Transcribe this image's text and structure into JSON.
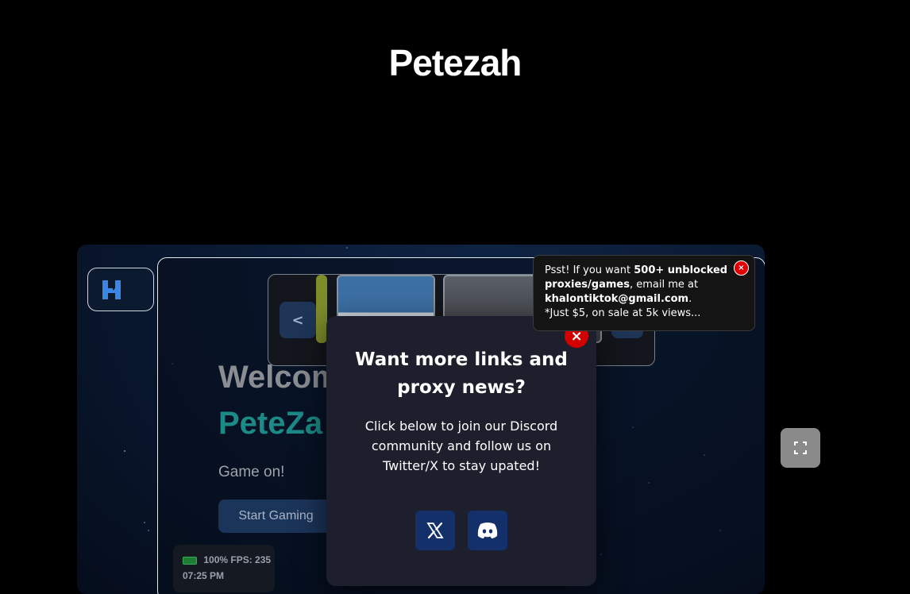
{
  "site": {
    "title": "Petezah"
  },
  "frame": {
    "carousel": {
      "prev_label": "<"
    },
    "hero": {
      "welcome": "Welcom",
      "brand": "PeteZa",
      "tagline": "Game on!",
      "start_button": "Start Gaming"
    },
    "status": {
      "battery": "100%",
      "fps": "FPS: 235",
      "time": "07:25 PM"
    }
  },
  "modal": {
    "title": "Want more links and proxy news?",
    "body": "Click below to join our Discord community and follow us on Twitter/X to stay upated!",
    "close_label": "×",
    "buttons": [
      {
        "name": "x-twitter-button",
        "icon": "x-logo-icon"
      },
      {
        "name": "discord-button",
        "icon": "discord-icon"
      }
    ]
  },
  "toast": {
    "intro": "Psst! If you want ",
    "highlight": "500+ unblocked proxies/games",
    "mid": ", email me at ",
    "email": "khalontiktok@gmail.com",
    "end": ".",
    "note": "*Just $5, on sale at 5k views...",
    "close_label": "×"
  },
  "colors": {
    "modal_bg": "#1e1f2c",
    "close_red": "#d30000",
    "social_blue": "#13306b",
    "brand_teal": "#1c8a87"
  }
}
